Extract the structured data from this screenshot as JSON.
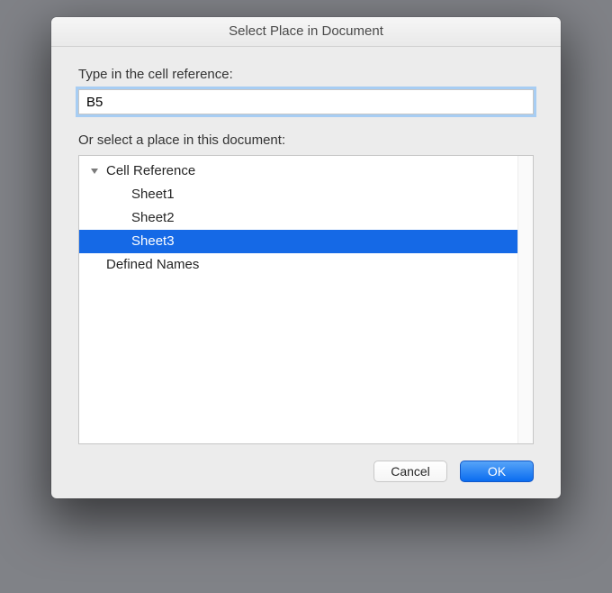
{
  "dialog": {
    "title": "Select Place in Document",
    "ref_label": "Type in the cell reference:",
    "ref_value": "B5",
    "place_label": "Or select a place in this document:"
  },
  "tree": {
    "group1": "Cell Reference",
    "items": [
      "Sheet1",
      "Sheet2",
      "Sheet3"
    ],
    "selected_index": 2,
    "group2": "Defined Names"
  },
  "buttons": {
    "cancel": "Cancel",
    "ok": "OK"
  }
}
